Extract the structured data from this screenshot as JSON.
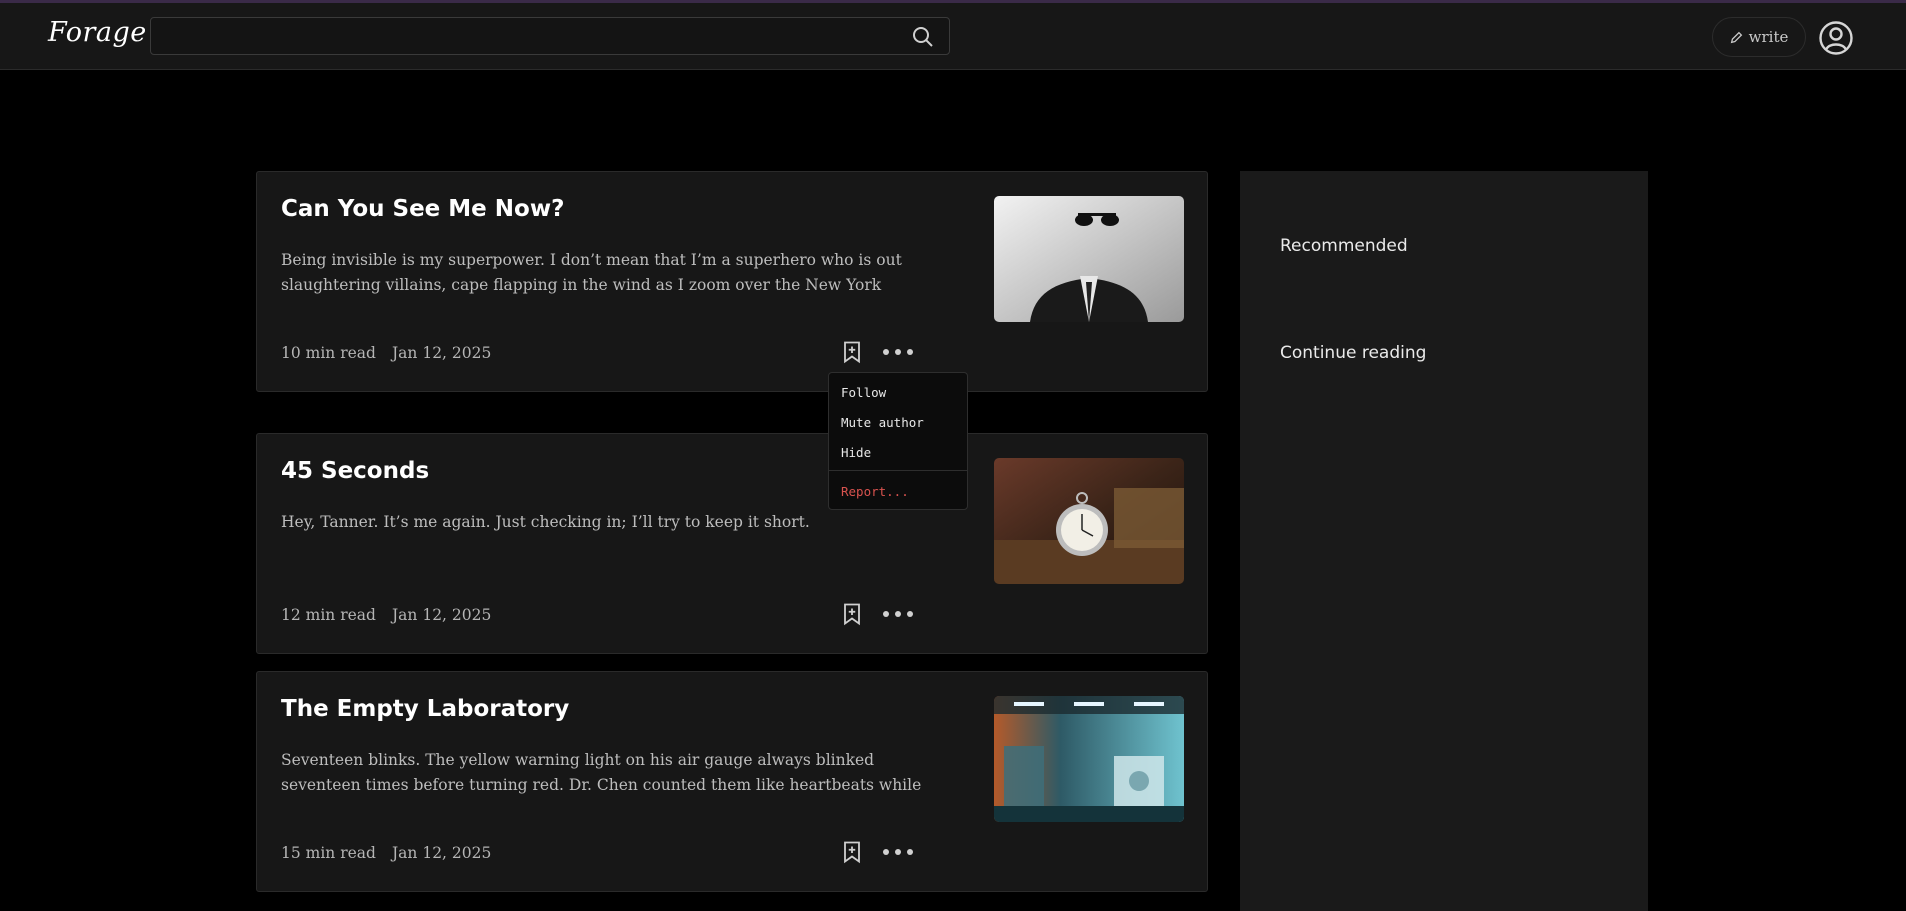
{
  "header": {
    "logo": "Forage",
    "search_placeholder": "",
    "write_label": "write"
  },
  "icons": {
    "search": "search-icon",
    "write": "pencil-icon",
    "avatar": "user-circle-icon",
    "bookmark": "bookmark-add-icon",
    "more": "more-horizontal-icon"
  },
  "colors": {
    "background": "#000000",
    "card": "#171717",
    "sidebar": "#1a1a1a",
    "report": "#d9534f"
  },
  "posts": [
    {
      "title": "Can You See Me Now?",
      "excerpt": "Being invisible is my superpower. I don’t mean that I’m a superhero who is out slaughtering villains, cape flapping in the wind as I zoom over the New York skyline.",
      "read_time": "10 min read",
      "date": "Jan 12, 2025"
    },
    {
      "title": "45 Seconds",
      "excerpt": "Hey, Tanner. It’s me again. Just checking in; I’ll try to keep it short.",
      "read_time": "12 min read",
      "date": "Jan 12, 2025"
    },
    {
      "title": "The Empty Laboratory",
      "excerpt": "Seventeen blinks. The yellow warning light on his air gauge always blinked seventeen times before turning red. Dr. Chen counted them like heartbeats while replacing hi...",
      "read_time": "15 min read",
      "date": "Jan 12, 2025"
    }
  ],
  "menu": {
    "follow": "Follow",
    "mute": "Mute author",
    "hide": "Hide",
    "report": "Report..."
  },
  "sidebar": {
    "recommended": "Recommended",
    "continue_reading": "Continue reading"
  }
}
